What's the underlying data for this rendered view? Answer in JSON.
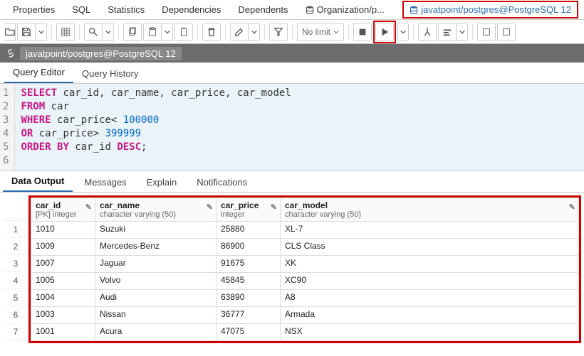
{
  "tabs": {
    "items": [
      "Properties",
      "SQL",
      "Statistics",
      "Dependencies",
      "Dependents"
    ],
    "org": "Organization/p...",
    "conn": "javatpoint/postgres@PostgreSQL 12"
  },
  "toolbar": {
    "nolimit": "No limit"
  },
  "crumb": {
    "path": "javatpoint/postgres@PostgreSQL 12"
  },
  "subtabs": {
    "query": "Query Editor",
    "history": "Query History"
  },
  "sql": {
    "l1": {
      "select": "SELECT",
      "rest": " car_id, car_name, car_price, car_model"
    },
    "l2": {
      "from": "FROM",
      "rest": " car"
    },
    "l3": {
      "where": "WHERE",
      "mid": " car_price< ",
      "num": "100000"
    },
    "l4": {
      "or": "OR",
      "mid": " car_price> ",
      "num": "399999"
    },
    "l5": {
      "order": "ORDER BY",
      "mid": " car_id ",
      "desc": "DESC",
      "semi": ";"
    }
  },
  "outtabs": {
    "data": "Data Output",
    "messages": "Messages",
    "explain": "Explain",
    "notifications": "Notifications"
  },
  "columns": [
    {
      "name": "car_id",
      "type": "[PK] integer"
    },
    {
      "name": "car_name",
      "type": "character varying (50)"
    },
    {
      "name": "car_price",
      "type": "integer"
    },
    {
      "name": "car_model",
      "type": "character varying (50)"
    }
  ],
  "rows": [
    {
      "n": "1",
      "car_id": "1010",
      "car_name": "Suzuki",
      "car_price": "25880",
      "car_model": "XL-7"
    },
    {
      "n": "2",
      "car_id": "1009",
      "car_name": "Mercedes-Benz",
      "car_price": "86900",
      "car_model": "CLS Class"
    },
    {
      "n": "3",
      "car_id": "1007",
      "car_name": "Jaguar",
      "car_price": "91675",
      "car_model": "XK"
    },
    {
      "n": "4",
      "car_id": "1005",
      "car_name": "Volvo",
      "car_price": "45845",
      "car_model": "XC90"
    },
    {
      "n": "5",
      "car_id": "1004",
      "car_name": "Audi",
      "car_price": "63890",
      "car_model": "A8"
    },
    {
      "n": "6",
      "car_id": "1003",
      "car_name": "Nissan",
      "car_price": "36777",
      "car_model": "Armada"
    },
    {
      "n": "7",
      "car_id": "1001",
      "car_name": "Acura",
      "car_price": "47075",
      "car_model": "NSX"
    }
  ]
}
